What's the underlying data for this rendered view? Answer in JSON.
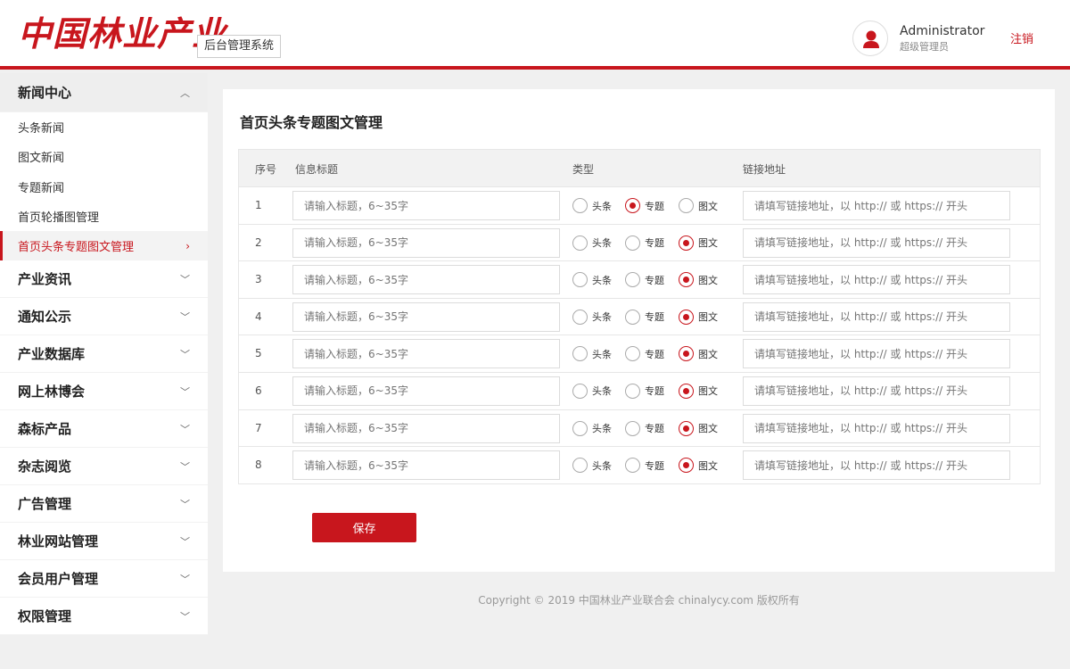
{
  "header": {
    "logo_text": "中国林业产业",
    "system_tag": "后台管理系统",
    "user_name": "Administrator",
    "user_role": "超级管理员",
    "logout_label": "注销"
  },
  "sidebar": {
    "open_group": {
      "label": "新闻中心",
      "items": [
        "头条新闻",
        "图文新闻",
        "专题新闻",
        "首页轮播图管理",
        "首页头条专题图文管理"
      ]
    },
    "active_item": "首页头条专题图文管理",
    "groups": [
      "产业资讯",
      "通知公示",
      "产业数据库",
      "网上林博会",
      "森标产品",
      "杂志阅览",
      "广告管理",
      "林业网站管理",
      "会员用户管理",
      "权限管理"
    ]
  },
  "main": {
    "title": "首页头条专题图文管理",
    "columns": {
      "index": "序号",
      "title": "信息标题",
      "type": "类型",
      "link": "链接地址"
    },
    "title_placeholder": "请输入标题，6~35字",
    "link_placeholder": "请填写链接地址，以 http:// 或 https:// 开头",
    "type_options": [
      "头条",
      "专题",
      "图文"
    ],
    "rows": [
      {
        "index": "1",
        "selected_type": "专题"
      },
      {
        "index": "2",
        "selected_type": "图文"
      },
      {
        "index": "3",
        "selected_type": "图文"
      },
      {
        "index": "4",
        "selected_type": "图文"
      },
      {
        "index": "5",
        "selected_type": "图文"
      },
      {
        "index": "6",
        "selected_type": "图文"
      },
      {
        "index": "7",
        "selected_type": "图文"
      },
      {
        "index": "8",
        "selected_type": "图文"
      }
    ],
    "save_label": "保存"
  },
  "footer": {
    "copyright": "Copyright © 2019 中国林业产业联合会 chinalycy.com 版权所有"
  },
  "colors": {
    "brand_red": "#c8161d",
    "panel_bg": "#ffffff",
    "page_bg": "#f0f0f0"
  }
}
